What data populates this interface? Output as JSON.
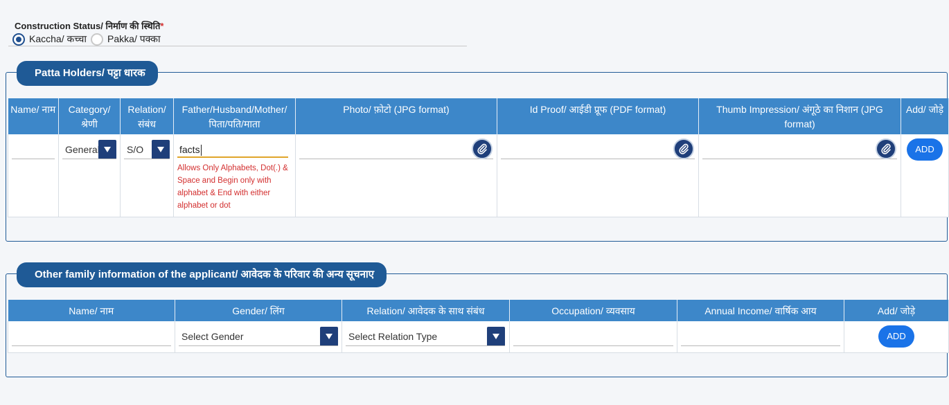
{
  "construction_status": {
    "label": "Construction Status/ निर्माण की स्थिति",
    "required_mark": "*",
    "options": [
      {
        "label": "Kaccha/ कच्चा",
        "selected": true
      },
      {
        "label": "Pakka/ पक्का",
        "selected": false
      }
    ]
  },
  "patta_holders": {
    "title": "Patta Holders/ पट्टा धारक",
    "columns": [
      "Name/ नाम",
      "Category/ श्रेणी",
      "Relation/ संबंध",
      "Father/Husband/Mother/ पिता/पति/माता",
      "Photo/ फ़ोटो (JPG format)",
      "Id Proof/ आईडी प्रूफ (PDF format)",
      "Thumb Impression/ अंगूठे का निशान (JPG format)",
      "Add/ जोड़े"
    ],
    "row": {
      "name": "",
      "category": "General",
      "relation": "S/O",
      "father_husband_mother": "facts",
      "error": "Allows Only Alphabets, Dot(.) & Space and Begin only with alphabet & End with either alphabet or dot",
      "add_label": "ADD"
    }
  },
  "other_family": {
    "title": "Other family information of the applicant/ आवेदक के परिवार की अन्य सूचनाए",
    "columns": [
      "Name/ नाम",
      "Gender/ लिंग",
      "Relation/ आवेदक के साथ संबंध",
      "Occupation/ व्यवसाय",
      "Annual Income/ वार्षिक आय",
      "Add/ जोड़े"
    ],
    "row": {
      "name": "",
      "gender_placeholder": "Select Gender",
      "relation_placeholder": "Select Relation Type",
      "occupation": "",
      "annual_income": "",
      "add_label": "ADD"
    }
  },
  "colors": {
    "header_bg": "#3d87c9",
    "legend_bg": "#1f5a96",
    "button_bg": "#1a73e8",
    "error": "#d32f2f"
  }
}
